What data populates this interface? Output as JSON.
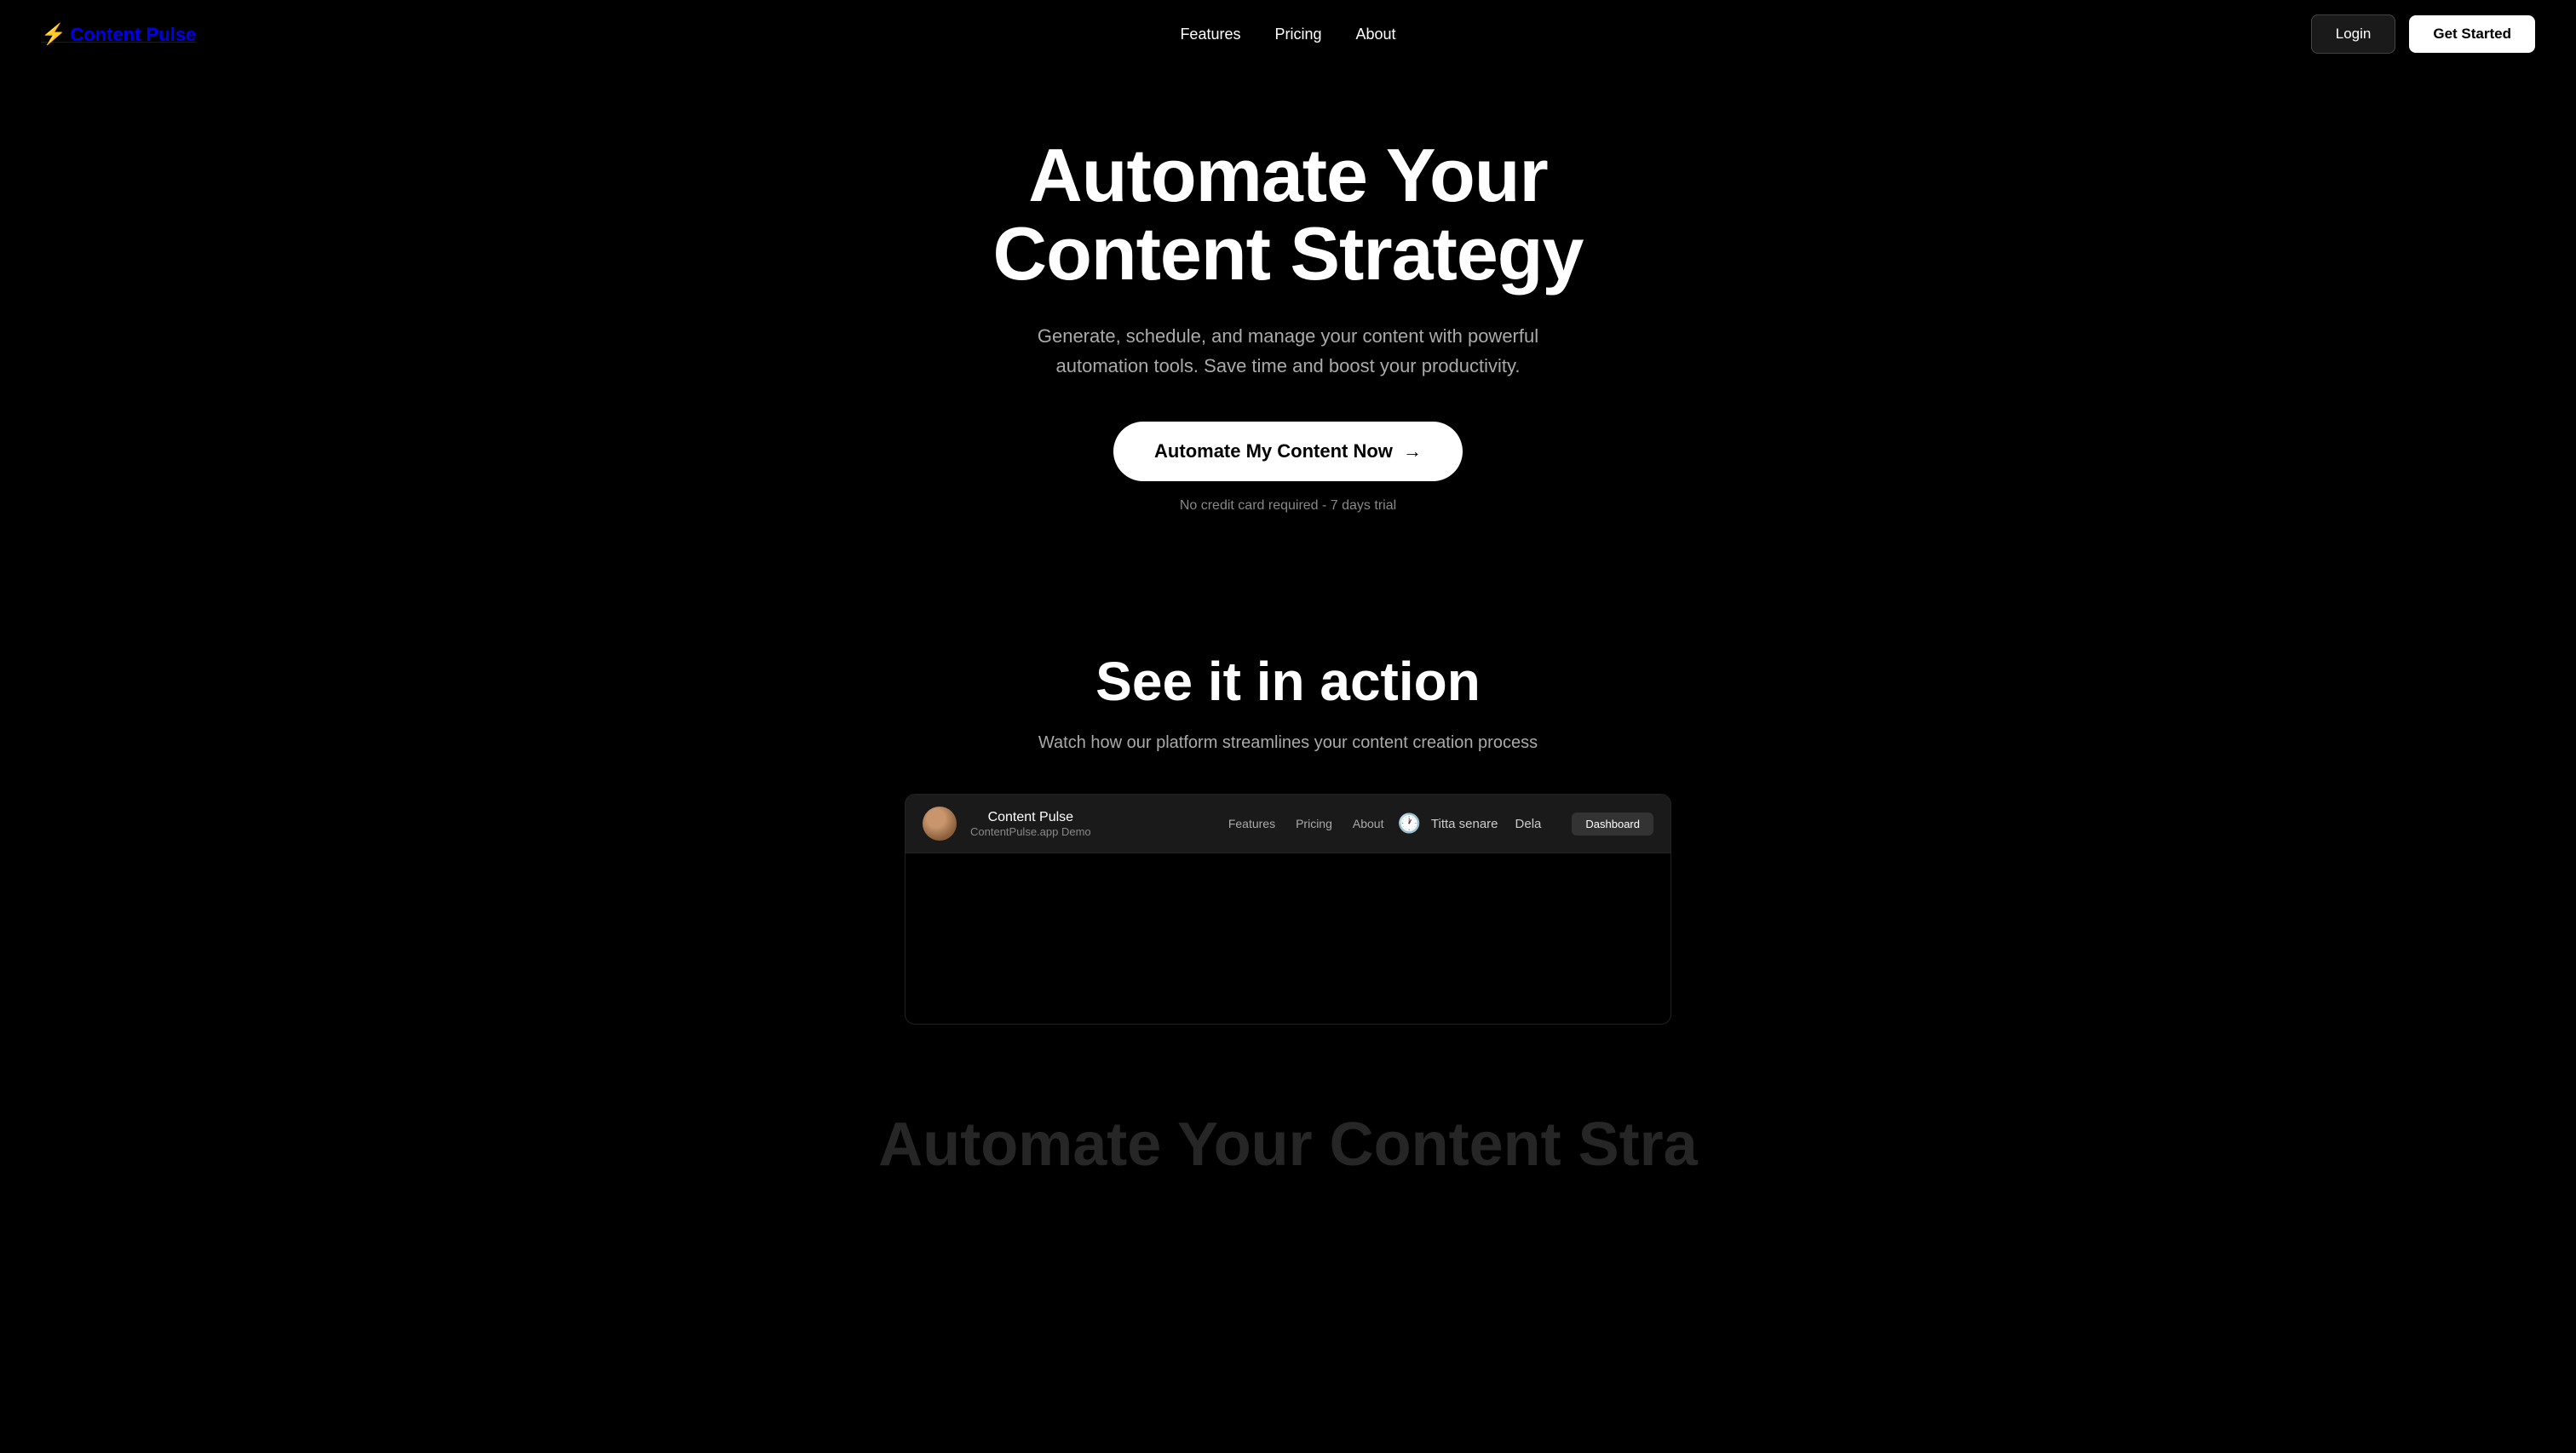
{
  "brand": {
    "name": "Content Pulse",
    "icon": "⚡"
  },
  "nav": {
    "links": [
      {
        "label": "Features",
        "id": "features"
      },
      {
        "label": "Pricing",
        "id": "pricing"
      },
      {
        "label": "About",
        "id": "about"
      }
    ],
    "login_label": "Login",
    "get_started_label": "Get Started"
  },
  "hero": {
    "title": "Automate Your Content Strategy",
    "subtitle": "Generate, schedule, and manage your content with powerful automation tools. Save time and boost your productivity.",
    "cta_label": "Automate My Content Now",
    "cta_arrow": "→",
    "note": "No credit card required - 7 days trial"
  },
  "section_action": {
    "title": "See it in action",
    "subtitle": "Watch how our platform streamlines your content creation process"
  },
  "video_preview": {
    "brand": "Content Pulse",
    "demo_label": "ContentPulse.app Demo",
    "nav_items": [
      "Features",
      "Pricing",
      "About"
    ],
    "watch_later_label": "Titta senare",
    "share_label": "Dela",
    "dashboard_label": "Dashboard"
  },
  "bottom_peek": {
    "title": "Automate Your Content Stra..."
  }
}
